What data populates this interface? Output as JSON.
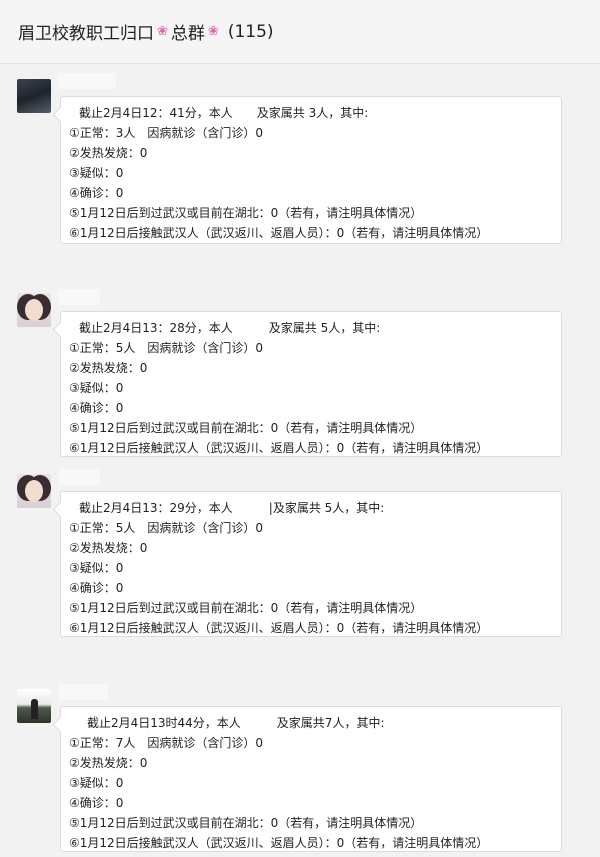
{
  "header": {
    "title_left": "眉卫校教职工归口",
    "flower1": "❀",
    "title_mid": "总群",
    "flower2": "❀",
    "count": "(115)"
  },
  "messages": [
    {
      "avatar_icon": "night-city-avatar-icon",
      "lines": [
        "截止2月4日12：41分，本人　　及家属共 3人，其中:",
        "①正常：3人　因病就诊（含门诊）0",
        "②发热发烧：0",
        "③疑似：0",
        "④确诊：0",
        "⑤1月12日后到过武汉或目前在湖北：0（若有，请注明具体情况）",
        "⑥1月12日后接触武汉人（武汉返川、返眉人员）：0（若有，请注明具体情况）"
      ]
    },
    {
      "avatar_icon": "girl-portrait-avatar-icon",
      "lines": [
        "截止2月4日13：28分，本人　　　及家属共 5人，其中:",
        "①正常：5人　因病就诊（含门诊）0",
        "②发热发烧：0",
        "③疑似：0",
        "④确诊：0",
        "⑤1月12日后到过武汉或目前在湖北：0（若有，请注明具体情况）",
        "⑥1月12日后接触武汉人（武汉返川、返眉人员）：0（若有，请注明具体情况）"
      ]
    },
    {
      "avatar_icon": "girl-portrait-avatar-icon",
      "lines": [
        "截止2月4日13：29分，本人　　　|及家属共 5人，其中:",
        "①正常：5人　因病就诊（含门诊）0",
        "②发热发烧：0",
        "③疑似：0",
        "④确诊：0",
        "⑤1月12日后到过武汉或目前在湖北：0（若有，请注明具体情况）",
        "⑥1月12日后接触武汉人（武汉返川、返眉人员）：0（若有，请注明具体情况）"
      ]
    },
    {
      "avatar_icon": "landscape-figure-avatar-icon",
      "lines": [
        "截止2月4日13时44分，本人　　　及家属共7人，其中:",
        "①正常：7人　因病就诊（含门诊）0",
        "②发热发烧：0",
        "③疑似：0",
        "④确诊：0",
        "⑤1月12日后到过武汉或目前在湖北：0（若有，请注明具体情况）",
        "⑥1月12日后接触武汉人（武汉返川、返眉人员）：0（若有，请注明具体情况）"
      ]
    }
  ]
}
